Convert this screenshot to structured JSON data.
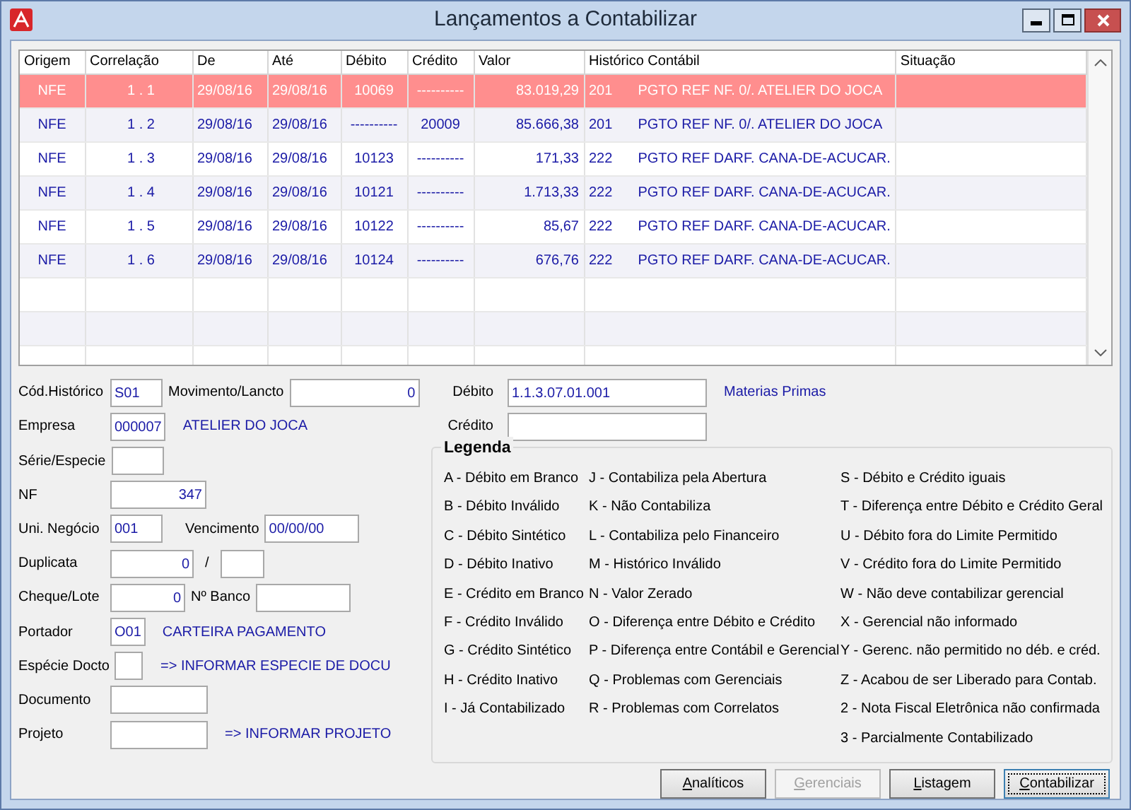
{
  "window": {
    "title": "Lançamentos a Contabilizar"
  },
  "table": {
    "columns": [
      "Origem",
      "Correlação",
      "De",
      "Até",
      "Débito",
      "Crédito",
      "Valor",
      "Histórico Contábil",
      "Situação"
    ],
    "rows": [
      {
        "selected": true,
        "origem": "NFE",
        "correlacao": "1 . 1",
        "de": "29/08/16",
        "ate": "29/08/16",
        "debito": "10069",
        "credito": "----------",
        "valor": "83.019,29",
        "hist_code": "201",
        "historico": "PGTO REF NF. 0/. ATELIER DO JOCA"
      },
      {
        "selected": false,
        "origem": "NFE",
        "correlacao": "1 . 2",
        "de": "29/08/16",
        "ate": "29/08/16",
        "debito": "----------",
        "credito": "20009",
        "valor": "85.666,38",
        "hist_code": "201",
        "historico": "PGTO REF NF. 0/. ATELIER DO JOCA"
      },
      {
        "selected": false,
        "origem": "NFE",
        "correlacao": "1 . 3",
        "de": "29/08/16",
        "ate": "29/08/16",
        "debito": "10123",
        "credito": "----------",
        "valor": "171,33",
        "hist_code": "222",
        "historico": "PGTO REF DARF. CANA-DE-ACUCAR."
      },
      {
        "selected": false,
        "origem": "NFE",
        "correlacao": "1 . 4",
        "de": "29/08/16",
        "ate": "29/08/16",
        "debito": "10121",
        "credito": "----------",
        "valor": "1.713,33",
        "hist_code": "222",
        "historico": "PGTO REF DARF. CANA-DE-ACUCAR."
      },
      {
        "selected": false,
        "origem": "NFE",
        "correlacao": "1 . 5",
        "de": "29/08/16",
        "ate": "29/08/16",
        "debito": "10122",
        "credito": "----------",
        "valor": "85,67",
        "hist_code": "222",
        "historico": "PGTO REF DARF. CANA-DE-ACUCAR."
      },
      {
        "selected": false,
        "origem": "NFE",
        "correlacao": "1 . 6",
        "de": "29/08/16",
        "ate": "29/08/16",
        "debito": "10124",
        "credito": "----------",
        "valor": "676,76",
        "hist_code": "222",
        "historico": "PGTO REF DARF. CANA-DE-ACUCAR."
      }
    ]
  },
  "form": {
    "left_rows": [
      {
        "label": "Cód.Histórico",
        "items": [
          {
            "kind": "field",
            "value": "S01"
          },
          {
            "kind": "label",
            "text": "Movimento/Lancto"
          },
          {
            "kind": "field",
            "value": "0",
            "numeric": true
          }
        ]
      },
      {
        "label": "Empresa",
        "items": [
          {
            "kind": "field",
            "value": "000007"
          },
          {
            "kind": "info",
            "text": "ATELIER DO JOCA"
          }
        ]
      },
      {
        "label": "Série/Especie",
        "items": [
          {
            "kind": "field"
          }
        ]
      },
      {
        "label": "NF",
        "items": [
          {
            "kind": "field",
            "value": "347",
            "numeric": true
          }
        ]
      },
      {
        "label": "Uni. Negócio",
        "items": [
          {
            "kind": "field",
            "value": "001"
          },
          {
            "kind": "label",
            "text": "Vencimento"
          },
          {
            "kind": "field",
            "value": "00/00/00"
          }
        ]
      },
      {
        "label": "Duplicata",
        "items": [
          {
            "kind": "field",
            "value": "0",
            "numeric": true
          },
          {
            "kind": "label",
            "text": "/"
          },
          {
            "kind": "field"
          }
        ]
      },
      {
        "label": "Cheque/Lote",
        "items": [
          {
            "kind": "field",
            "value": "0",
            "numeric": true
          },
          {
            "kind": "label",
            "text": "Nº Banco"
          },
          {
            "kind": "field"
          }
        ]
      },
      {
        "label": "Portador",
        "items": [
          {
            "kind": "field",
            "value": "O01"
          },
          {
            "kind": "info",
            "text": "CARTEIRA PAGAMENTO"
          }
        ]
      },
      {
        "label": "Espécie Docto",
        "items": [
          {
            "kind": "field"
          },
          {
            "kind": "info",
            "text": "=> INFORMAR ESPECIE DE DOCU"
          }
        ]
      },
      {
        "label": "Documento",
        "items": [
          {
            "kind": "field"
          }
        ]
      },
      {
        "label": "Projeto",
        "items": [
          {
            "kind": "field"
          },
          {
            "kind": "info",
            "text": "=> INFORMAR PROJETO"
          }
        ]
      }
    ],
    "debito": {
      "label": "Débito",
      "value": "1.1.3.07.01.001",
      "description": "Materias Primas"
    },
    "credito": {
      "label": "Crédito"
    }
  },
  "legend": {
    "title": "Legenda",
    "columns": [
      [
        "A - Débito em Branco",
        "B - Débito Inválido",
        "C - Débito Sintético",
        "D - Débito Inativo",
        "E - Crédito em Branco",
        "F - Crédito Inválido",
        "G - Crédito Sintético",
        "H - Crédito Inativo",
        "I - Já Contabilizado"
      ],
      [
        "J - Contabiliza pela Abertura",
        "K - Não Contabiliza",
        "L - Contabiliza pelo Financeiro",
        "M - Histórico Inválido",
        "N - Valor Zerado",
        "O - Diferença entre Débito e Crédito",
        "P - Diferença entre Contábil e Gerencial",
        "Q - Problemas com Gerenciais",
        "R - Problemas com Correlatos"
      ],
      [
        "S - Débito e Crédito iguais",
        "T - Diferença entre Débito e Crédito Geral",
        "U - Débito fora do Limite Permitido",
        "V - Crédito fora do Limite Permitido",
        "W - Não deve contabilizar gerencial",
        "X - Gerencial não informado",
        "Y - Gerenc. não permitido no déb. e créd.",
        "Z - Acabou de ser Liberado para Contab.",
        "2 - Nota Fiscal Eletrônica não confirmada",
        "3 - Parcialmente Contabilizado"
      ]
    ]
  },
  "buttons": [
    {
      "label": "Analíticos",
      "disabled": false,
      "focused": false
    },
    {
      "label": "Gerenciais",
      "disabled": true,
      "focused": false
    },
    {
      "label": "Listagem",
      "disabled": false,
      "focused": false
    },
    {
      "label": "Contabilizar",
      "disabled": false,
      "focused": true
    }
  ]
}
